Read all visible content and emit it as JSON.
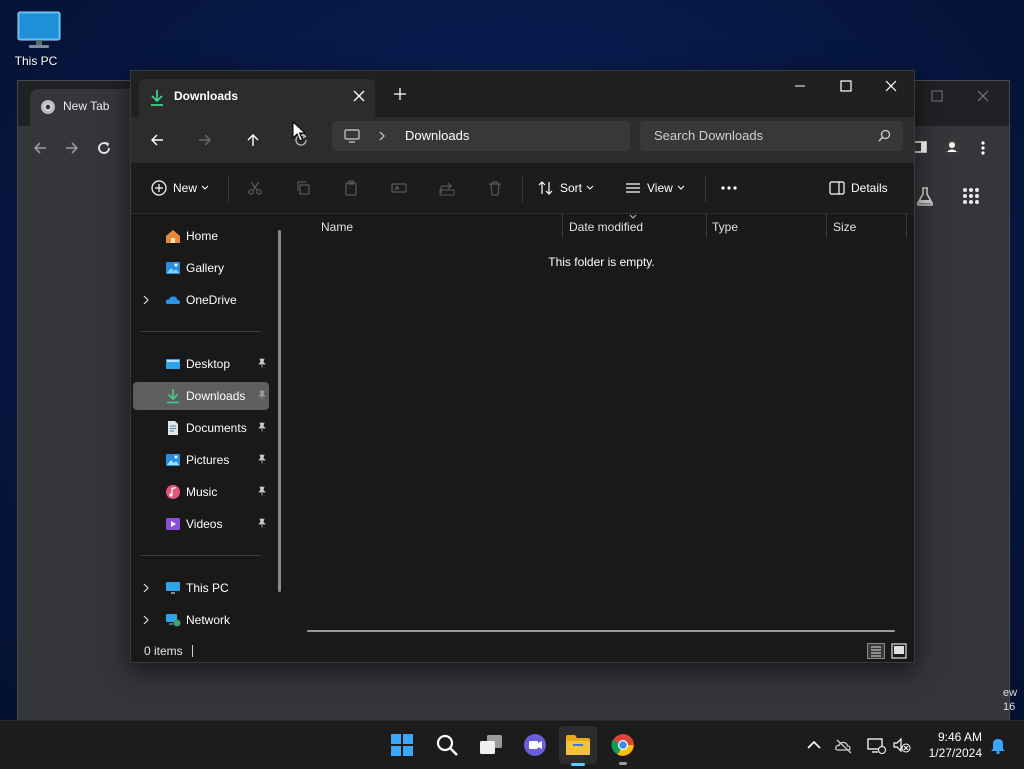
{
  "desktop": {
    "icon_label": "This PC",
    "overflow_text_1": "ew",
    "overflow_text_2": "16"
  },
  "chrome": {
    "tab_title": "New Tab"
  },
  "explorer": {
    "tab_title": "Downloads",
    "address": {
      "location": "Downloads"
    },
    "search_placeholder": "Search Downloads",
    "commands": {
      "new": "New",
      "sort": "Sort",
      "view": "View",
      "details": "Details"
    },
    "nav": {
      "home": "Home",
      "gallery": "Gallery",
      "onedrive": "OneDrive",
      "desktop": "Desktop",
      "downloads": "Downloads",
      "documents": "Documents",
      "pictures": "Pictures",
      "music": "Music",
      "videos": "Videos",
      "this_pc": "This PC",
      "network": "Network"
    },
    "columns": {
      "name": "Name",
      "date": "Date modified",
      "type": "Type",
      "size": "Size"
    },
    "empty_message": "This folder is empty.",
    "status": {
      "count": "0 items"
    }
  },
  "taskbar": {
    "time": "9:46 AM",
    "date": "1/27/2024"
  },
  "colors": {
    "accent": "#60cdff",
    "folder": "#f5c33b",
    "downloads_green": "#3fd28a"
  }
}
